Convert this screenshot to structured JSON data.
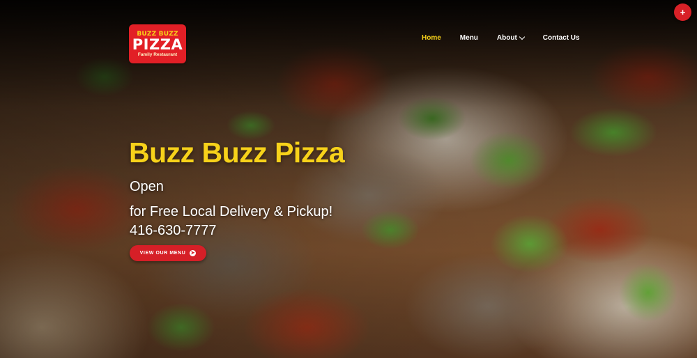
{
  "logo": {
    "top_text": "BUZZ BUZZ",
    "main_text": "PIZZA",
    "sub_text": "Family Restaurant"
  },
  "nav": {
    "items": [
      {
        "label": "Home",
        "active": true
      },
      {
        "label": "Menu",
        "active": false
      },
      {
        "label": "About",
        "active": false,
        "has_dropdown": true
      },
      {
        "label": "Contact Us",
        "active": false
      }
    ]
  },
  "plus_button": {
    "label": "+"
  },
  "hero": {
    "title": "Buzz Buzz Pizza",
    "status": "Open",
    "tagline": "for Free Local Delivery & Pickup!",
    "phone": "416-630-7777",
    "cta_label": "VIEW OUR MENU",
    "cta_icon": "arrow-right-circle-icon"
  },
  "colors": {
    "accent_yellow": "#f7d21a",
    "brand_red": "#d61f27",
    "text_white": "#ffffff"
  }
}
